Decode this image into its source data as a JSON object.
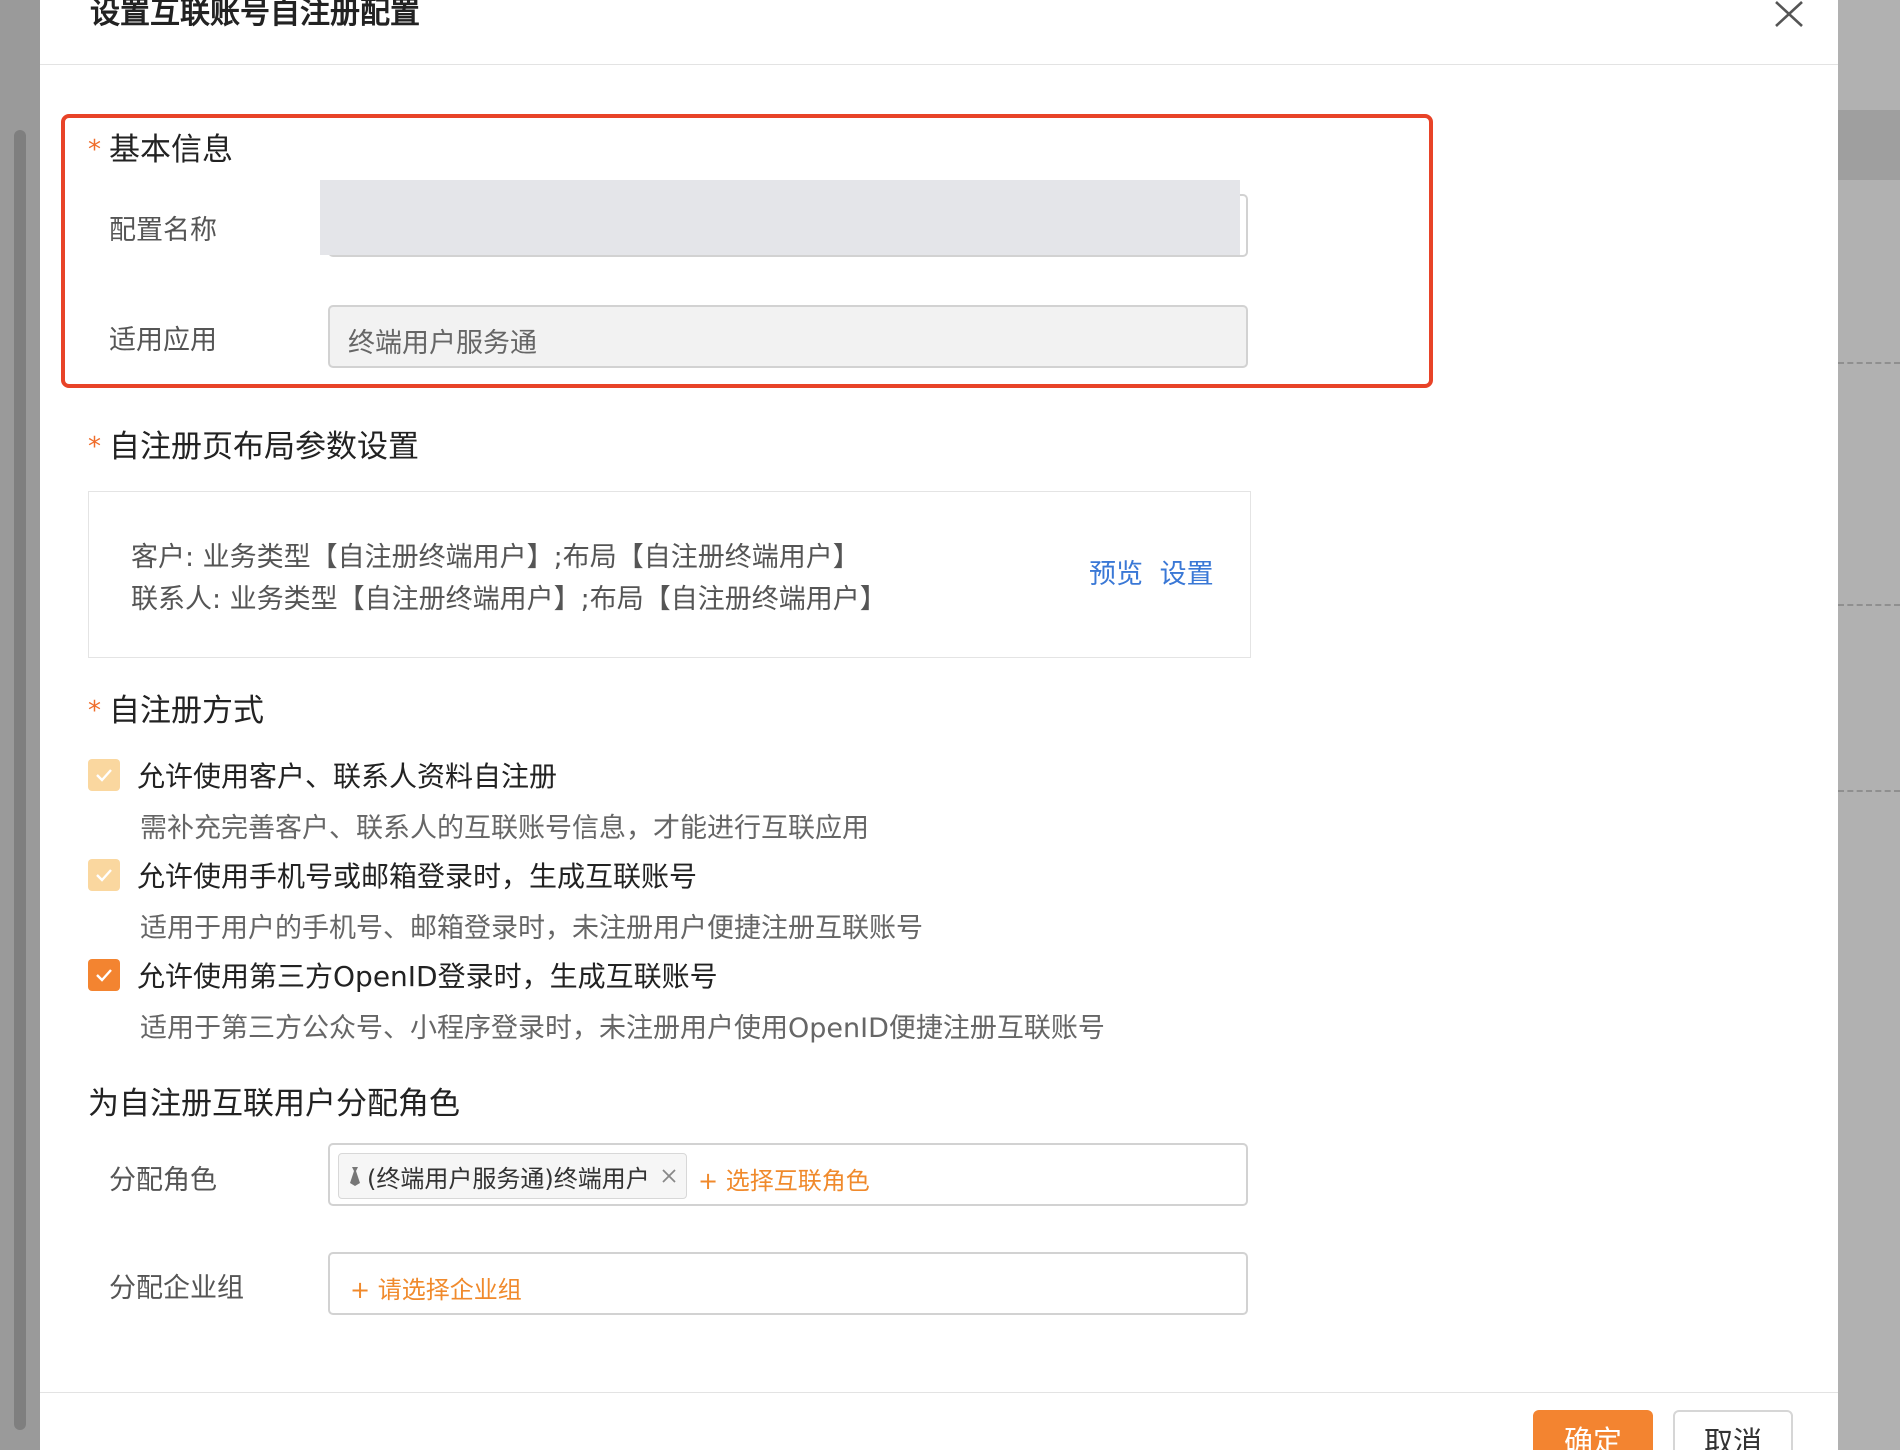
{
  "modal": {
    "title": "设置互联账号自注册配置",
    "confirm_label": "确定",
    "cancel_label": "取消"
  },
  "basic_info": {
    "section_title": "基本信息",
    "config_name_label": "配置名称",
    "config_name_value": "",
    "app_label": "适用应用",
    "app_value": "终端用户服务通"
  },
  "layout_settings": {
    "section_title": "自注册页布局参数设置",
    "lines": [
      "客户: 业务类型【自注册终端用户】;布局【自注册终端用户】",
      "联系人: 业务类型【自注册终端用户】;布局【自注册终端用户】"
    ],
    "preview_label": "预览",
    "settings_label": "设置"
  },
  "registration_method": {
    "section_title": "自注册方式",
    "options": [
      {
        "label": "允许使用客户、联系人资料自注册",
        "description": "需补充完善客户、联系人的互联账号信息，才能进行互联应用",
        "checked": true,
        "disabled": true
      },
      {
        "label": "允许使用手机号或邮箱登录时，生成互联账号",
        "description": "适用于用户的手机号、邮箱登录时，未注册用户便捷注册互联账号",
        "checked": true,
        "disabled": true
      },
      {
        "label": "允许使用第三方OpenID登录时，生成互联账号",
        "description": "适用于第三方公众号、小程序登录时，未注册用户使用OpenID便捷注册互联账号",
        "checked": true,
        "disabled": false
      }
    ]
  },
  "role_assignment": {
    "section_title": "为自注册互联用户分配角色",
    "role_label": "分配角色",
    "role_tag": "(终端用户服务通)终端用户",
    "add_role": "+ 选择互联角色",
    "group_label": "分配企业组",
    "add_group": "+ 请选择企业组"
  },
  "colors": {
    "accent": "#f38430",
    "highlight_box": "#e84328",
    "link": "#3a78d6",
    "required_mark": "#ef6d2b"
  }
}
